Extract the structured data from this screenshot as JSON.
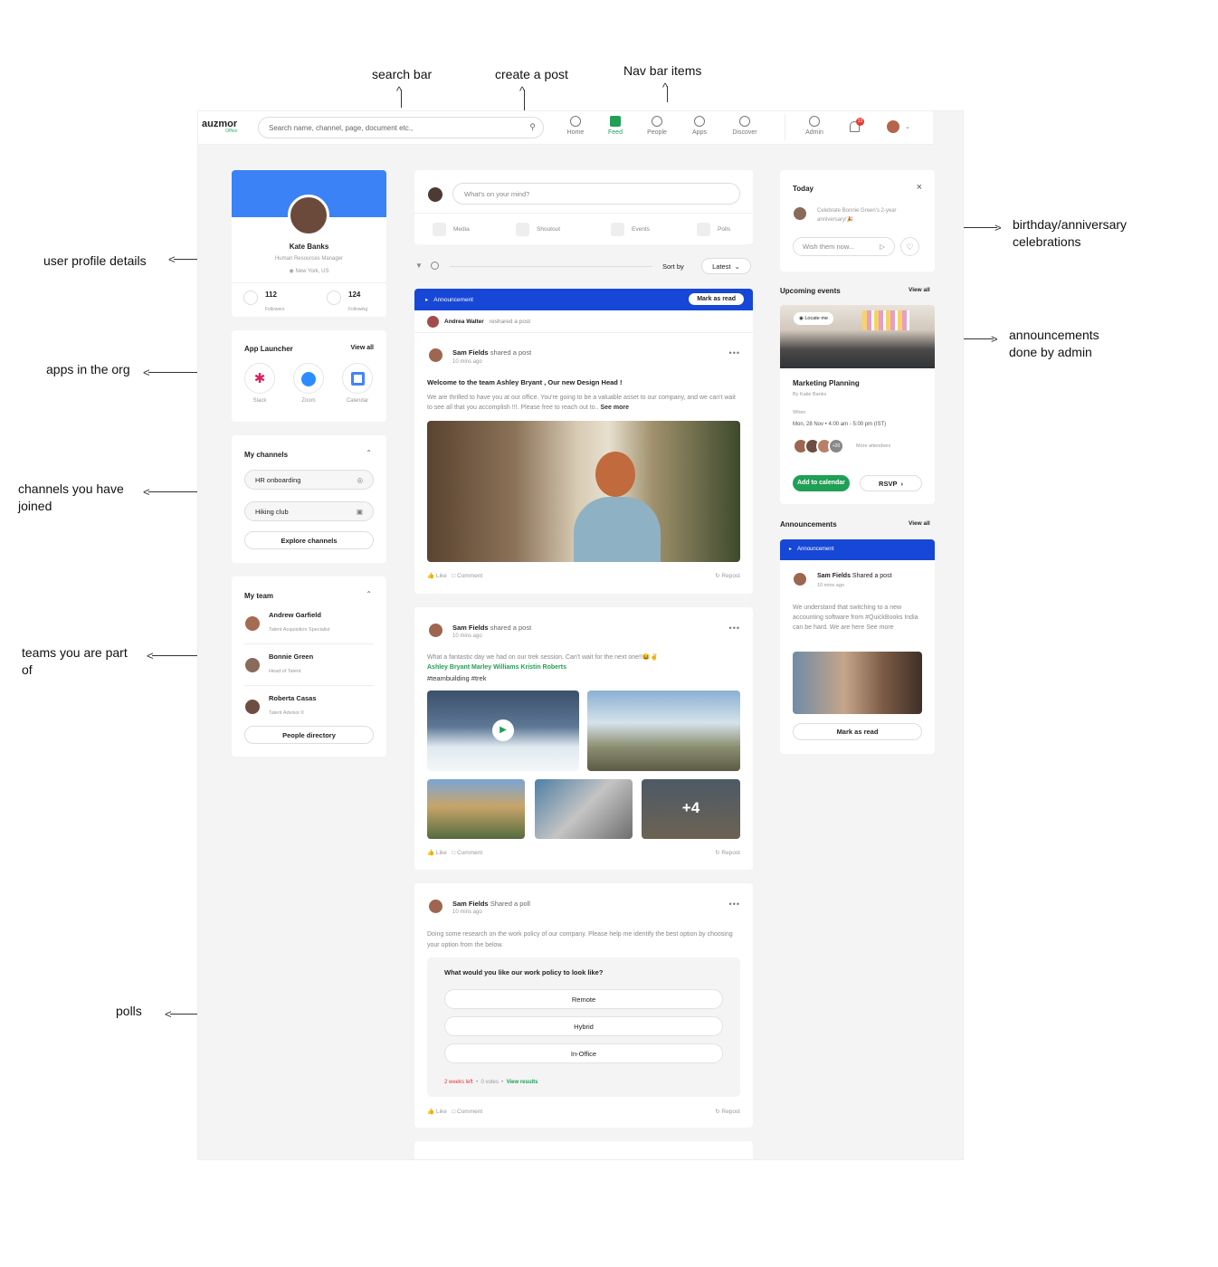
{
  "annotations": {
    "search_bar": "search bar",
    "create_post": "create a post",
    "nav_items": "Nav bar items",
    "user_profile": "user profile details",
    "apps": "apps in the org",
    "channels_1": "channels you have",
    "channels_2": "joined",
    "teams_1": "teams you are part",
    "teams_2": "of",
    "polls": "polls",
    "birthday_1": "birthday/anniversary",
    "birthday_2": "celebrations",
    "announcements_1": "announcements",
    "announcements_2": "done by admin"
  },
  "header": {
    "logo": "auzmor",
    "logo_sub": "Office",
    "search_placeholder": "Search name, channel, page, document etc.,",
    "nav": [
      {
        "label": "Home",
        "icon": "home-icon"
      },
      {
        "label": "Feed",
        "icon": "feed-icon",
        "active": true
      },
      {
        "label": "People",
        "icon": "people-icon"
      },
      {
        "label": "Apps",
        "icon": "apps-icon"
      },
      {
        "label": "Discover",
        "icon": "discover-icon"
      }
    ],
    "admin": "Admin",
    "notif_count": "13"
  },
  "profile": {
    "name": "Kate Banks",
    "title": "Human Resources Manager",
    "location": "New York, US",
    "followers": "112",
    "followers_label": "Followers",
    "following": "124",
    "following_label": "Following"
  },
  "app_launcher": {
    "title": "App Launcher",
    "view_all": "View all",
    "apps": [
      "Slack",
      "Zoom",
      "Calendar"
    ]
  },
  "channels": {
    "title": "My channels",
    "items": [
      "HR onboarding",
      "Hiking club"
    ],
    "explore": "Explore channels"
  },
  "team": {
    "title": "My team",
    "members": [
      {
        "name": "Andrew Garfield",
        "role": "Talent Acquisition Specialist"
      },
      {
        "name": "Bonnie Green",
        "role": "Head of Talent"
      },
      {
        "name": "Roberta Casas",
        "role": "Talent Advisor II"
      }
    ],
    "directory": "People directory"
  },
  "composer": {
    "placeholder": "What's on your mind?",
    "actions": [
      "Media",
      "Shoutout",
      "Events",
      "Polls"
    ]
  },
  "sort": {
    "label": "Sort by",
    "value": "Latest"
  },
  "post1": {
    "banner": "Announcement",
    "mark_read": "Mark as read",
    "reshare_name": "Andrea Walter",
    "reshare_text": "reshared a post",
    "author": "Sam Fields",
    "action": "shared a post",
    "time": "10 mins ago",
    "headline": "Welcome to the team Ashley Bryant , Our new Design Head !",
    "body": "We are thrilled to have you at our office. You're going to be a valuable asset to our company, and we can't wait to see all that you accomplish !!!. Please free to reach out to..",
    "see_more": "See more"
  },
  "post2": {
    "author": "Sam Fields",
    "action": "shared a post",
    "time": "10 mins ago",
    "body": "What a fantastic day we had on our trek session. Can't wait for the next one!!",
    "emoji": "😆✌",
    "mentions": "Ashley Bryant  Marley Williams  Kristin Roberts",
    "tags": "#teambuilding  #trek",
    "more": "+4"
  },
  "post3": {
    "author": "Sam Fields",
    "action": "Shared a poll",
    "time": "10 mins ago",
    "body": "Doing some research on the work policy of our company. Please help me identify the best option by choosing your option from the below.",
    "question": "What would you like our work policy to look like?",
    "options": [
      "Remote",
      "Hybrid",
      "In-Office"
    ],
    "time_left": "2 weeks left",
    "votes": "0 votes",
    "view": "View results"
  },
  "post_actions": {
    "like": "Like",
    "comment": "Comment",
    "repost": "Repost"
  },
  "today": {
    "title": "Today",
    "text": "Celebrate Bonnie Green's 2-year anniversary!",
    "emoji": "🎉",
    "wish": "Wish them now..."
  },
  "events": {
    "title": "Upcoming events",
    "view_all": "View all",
    "locate": "Locate me",
    "name": "Marketing Planning",
    "by": "By Katie Banks",
    "when_label": "When",
    "when": "Mon, 28 Nov  •  4:00 am - 5:00 pm (IST)",
    "more_count": "+20",
    "more_attendees": "More attendees",
    "add": "Add to calendar",
    "rsvp": "RSVP"
  },
  "announcements": {
    "title": "Announcements",
    "view_all": "View all",
    "banner": "Announcement",
    "author": "Sam Fields",
    "action": "Shared a post",
    "time": "10 mins ago",
    "body": "We understand that switching to a new accounting software from #QuickBooks India can be hard. We are here See more",
    "mark_read": "Mark as read"
  },
  "colors": {
    "blue": "#1747d6",
    "green": "#1fa055",
    "profile_blue": "#3b82f6"
  }
}
